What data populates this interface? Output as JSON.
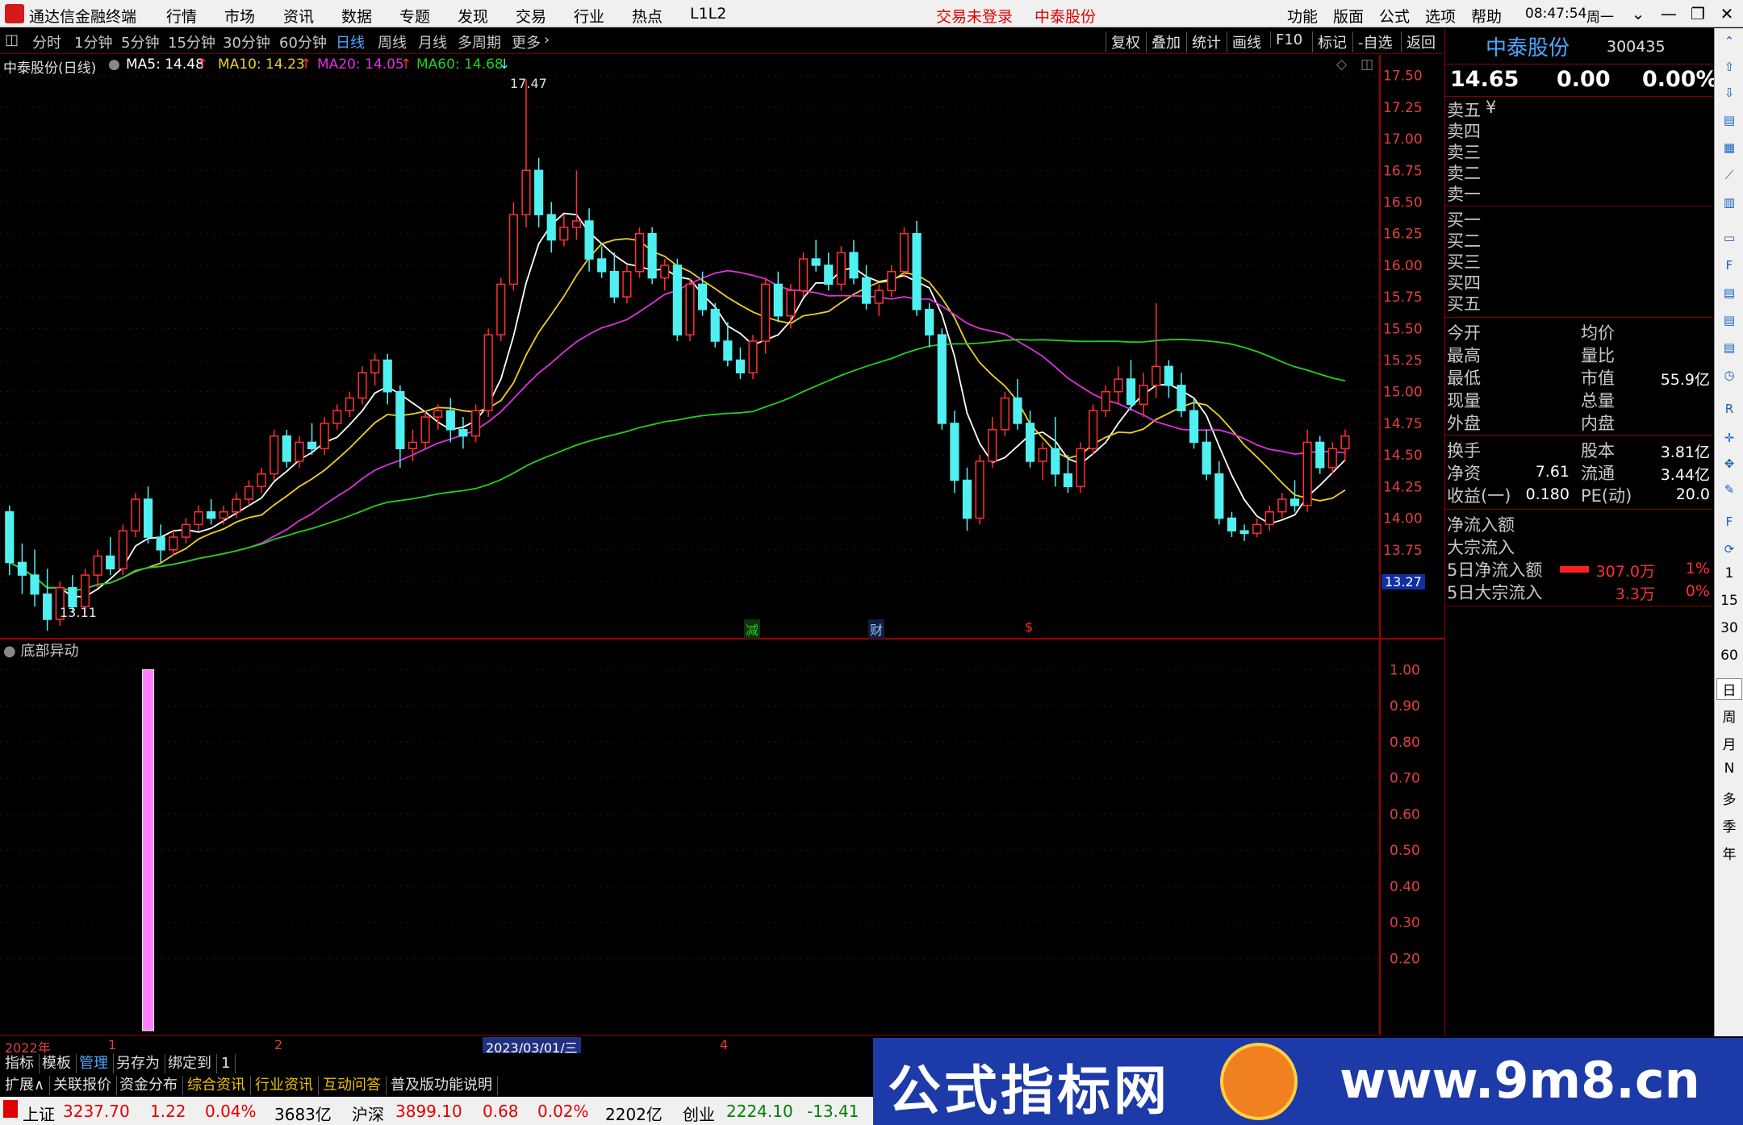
{
  "menubar": {
    "app_title": "通达信金融终端",
    "items": [
      "行情",
      "市场",
      "资讯",
      "数据",
      "专题",
      "发现",
      "交易",
      "行业",
      "热点",
      "L1L2"
    ],
    "login_status": "交易未登录",
    "stock_name": "中泰股份",
    "right_items": [
      "功能",
      "版面",
      "公式",
      "选项",
      "帮助"
    ],
    "clock": "08:47:54",
    "weekday": "周一"
  },
  "periodbar": {
    "items": [
      "分时",
      "1分钟",
      "5分钟",
      "15分钟",
      "30分钟",
      "60分钟",
      "日线",
      "周线",
      "月线",
      "多周期",
      "更多"
    ],
    "active": "日线",
    "right_items": [
      "复权",
      "叠加",
      "统计",
      "画线",
      "F10",
      "标记",
      "-自选",
      "返回"
    ]
  },
  "chart_info": {
    "title": "中泰股份(日线)",
    "ma5": "MA5: 14.48",
    "ma10": "MA10: 14.23",
    "ma20": "MA20: 14.05",
    "ma60": "MA60: 14.68",
    "high_label": "17.47",
    "low_label": "13.11",
    "price_tag": "13.27",
    "event_markers": [
      "减",
      "财",
      "$"
    ],
    "colors": {
      "ma5": "#ffffff",
      "ma10": "#f0d020",
      "ma20": "#e030e0",
      "ma60": "#20d020",
      "up": "#ff3030",
      "down": "#50f0f0"
    }
  },
  "chart_data": [
    {
      "type": "candlestick",
      "title": "中泰股份(日线)",
      "y_ticks": [
        "17.50",
        "17.25",
        "17.00",
        "16.75",
        "16.50",
        "16.25",
        "16.00",
        "15.75",
        "15.50",
        "15.25",
        "15.00",
        "14.75",
        "14.50",
        "14.25",
        "14.00",
        "13.75",
        "13.50"
      ],
      "ylim": [
        13.2,
        17.6
      ],
      "ohlc": [
        [
          14.05,
          14.1,
          13.55,
          13.65
        ],
        [
          13.65,
          13.8,
          13.4,
          13.55
        ],
        [
          13.55,
          13.75,
          13.3,
          13.4
        ],
        [
          13.4,
          13.6,
          13.11,
          13.2
        ],
        [
          13.2,
          13.5,
          13.15,
          13.45
        ],
        [
          13.45,
          13.55,
          13.25,
          13.3
        ],
        [
          13.3,
          13.6,
          13.25,
          13.55
        ],
        [
          13.55,
          13.75,
          13.45,
          13.7
        ],
        [
          13.7,
          13.85,
          13.55,
          13.6
        ],
        [
          13.6,
          13.95,
          13.55,
          13.9
        ],
        [
          13.9,
          14.2,
          13.85,
          14.15
        ],
        [
          14.15,
          14.25,
          13.8,
          13.85
        ],
        [
          13.85,
          13.95,
          13.65,
          13.75
        ],
        [
          13.75,
          13.9,
          13.7,
          13.85
        ],
        [
          13.85,
          14.0,
          13.8,
          13.95
        ],
        [
          13.95,
          14.1,
          13.9,
          14.05
        ],
        [
          14.05,
          14.15,
          13.95,
          14.0
        ],
        [
          14.0,
          14.1,
          13.95,
          14.05
        ],
        [
          14.05,
          14.2,
          14.0,
          14.15
        ],
        [
          14.15,
          14.3,
          14.1,
          14.25
        ],
        [
          14.25,
          14.4,
          14.2,
          14.35
        ],
        [
          14.35,
          14.7,
          14.3,
          14.65
        ],
        [
          14.65,
          14.7,
          14.4,
          14.45
        ],
        [
          14.45,
          14.65,
          14.4,
          14.6
        ],
        [
          14.6,
          14.75,
          14.5,
          14.55
        ],
        [
          14.55,
          14.8,
          14.5,
          14.75
        ],
        [
          14.75,
          14.9,
          14.7,
          14.85
        ],
        [
          14.85,
          15.0,
          14.8,
          14.95
        ],
        [
          14.95,
          15.2,
          14.9,
          15.15
        ],
        [
          15.15,
          15.3,
          15.05,
          15.25
        ],
        [
          15.25,
          15.3,
          14.9,
          15.0
        ],
        [
          15.0,
          15.05,
          14.4,
          14.55
        ],
        [
          14.55,
          14.7,
          14.45,
          14.6
        ],
        [
          14.6,
          14.85,
          14.55,
          14.8
        ],
        [
          14.8,
          14.9,
          14.7,
          14.85
        ],
        [
          14.85,
          14.95,
          14.6,
          14.7
        ],
        [
          14.7,
          14.8,
          14.55,
          14.65
        ],
        [
          14.65,
          14.9,
          14.6,
          14.85
        ],
        [
          14.85,
          15.5,
          14.8,
          15.45
        ],
        [
          15.45,
          15.9,
          15.4,
          15.85
        ],
        [
          15.85,
          16.5,
          15.8,
          16.4
        ],
        [
          16.4,
          17.47,
          16.3,
          16.75
        ],
        [
          16.75,
          16.85,
          16.3,
          16.4
        ],
        [
          16.4,
          16.5,
          16.1,
          16.2
        ],
        [
          16.2,
          16.4,
          16.15,
          16.3
        ],
        [
          16.3,
          16.75,
          16.2,
          16.35
        ],
        [
          16.35,
          16.45,
          15.95,
          16.05
        ],
        [
          16.05,
          16.15,
          15.9,
          15.95
        ],
        [
          15.95,
          16.1,
          15.7,
          15.75
        ],
        [
          15.75,
          16.0,
          15.7,
          15.95
        ],
        [
          15.95,
          16.3,
          15.9,
          16.25
        ],
        [
          16.25,
          16.3,
          15.85,
          15.9
        ],
        [
          15.9,
          16.05,
          15.8,
          16.0
        ],
        [
          16.0,
          16.05,
          15.4,
          15.45
        ],
        [
          15.45,
          15.9,
          15.4,
          15.85
        ],
        [
          15.85,
          15.95,
          15.6,
          15.65
        ],
        [
          15.65,
          15.7,
          15.35,
          15.4
        ],
        [
          15.4,
          15.55,
          15.2,
          15.25
        ],
        [
          15.25,
          15.35,
          15.1,
          15.15
        ],
        [
          15.15,
          15.45,
          15.1,
          15.4
        ],
        [
          15.4,
          15.9,
          15.3,
          15.85
        ],
        [
          15.85,
          15.95,
          15.55,
          15.6
        ],
        [
          15.6,
          15.85,
          15.5,
          15.8
        ],
        [
          15.8,
          16.1,
          15.75,
          16.05
        ],
        [
          16.05,
          16.2,
          15.95,
          16.0
        ],
        [
          16.0,
          16.1,
          15.8,
          15.85
        ],
        [
          15.85,
          16.15,
          15.8,
          16.1
        ],
        [
          16.1,
          16.2,
          15.85,
          15.9
        ],
        [
          15.9,
          16.0,
          15.65,
          15.7
        ],
        [
          15.7,
          15.85,
          15.6,
          15.8
        ],
        [
          15.8,
          16.0,
          15.75,
          15.95
        ],
        [
          15.95,
          16.3,
          15.9,
          16.25
        ],
        [
          16.25,
          16.35,
          15.6,
          15.65
        ],
        [
          15.65,
          15.7,
          15.35,
          15.45
        ],
        [
          15.45,
          15.5,
          14.7,
          14.75
        ],
        [
          14.75,
          14.85,
          14.2,
          14.3
        ],
        [
          14.3,
          14.4,
          13.9,
          14.0
        ],
        [
          14.0,
          14.5,
          13.95,
          14.45
        ],
        [
          14.45,
          14.8,
          14.4,
          14.7
        ],
        [
          14.7,
          15.0,
          14.65,
          14.95
        ],
        [
          14.95,
          15.1,
          14.7,
          14.75
        ],
        [
          14.75,
          14.85,
          14.4,
          14.45
        ],
        [
          14.45,
          14.6,
          14.3,
          14.55
        ],
        [
          14.55,
          14.8,
          14.25,
          14.35
        ],
        [
          14.35,
          14.5,
          14.2,
          14.25
        ],
        [
          14.25,
          14.6,
          14.2,
          14.55
        ],
        [
          14.55,
          14.9,
          14.5,
          14.85
        ],
        [
          14.85,
          15.05,
          14.8,
          15.0
        ],
        [
          15.0,
          15.2,
          14.9,
          15.1
        ],
        [
          15.1,
          15.25,
          14.85,
          14.9
        ],
        [
          14.9,
          15.15,
          14.8,
          15.05
        ],
        [
          15.05,
          15.7,
          14.95,
          15.2
        ],
        [
          15.2,
          15.25,
          14.95,
          15.05
        ],
        [
          15.05,
          15.15,
          14.8,
          14.85
        ],
        [
          14.85,
          14.95,
          14.55,
          14.6
        ],
        [
          14.6,
          14.7,
          14.3,
          14.35
        ],
        [
          14.35,
          14.45,
          13.95,
          14.0
        ],
        [
          14.0,
          14.05,
          13.85,
          13.9
        ],
        [
          13.9,
          13.95,
          13.82,
          13.88
        ],
        [
          13.88,
          14.0,
          13.85,
          13.95
        ],
        [
          13.95,
          14.1,
          13.9,
          14.05
        ],
        [
          14.05,
          14.2,
          14.0,
          14.15
        ],
        [
          14.15,
          14.3,
          14.05,
          14.1
        ],
        [
          14.1,
          14.7,
          14.05,
          14.6
        ],
        [
          14.6,
          14.65,
          14.35,
          14.4
        ],
        [
          14.4,
          14.6,
          14.35,
          14.55
        ],
        [
          14.55,
          14.7,
          14.45,
          14.65
        ]
      ]
    },
    {
      "type": "bar",
      "title": "底部异动",
      "y_ticks": [
        "1.00",
        "0.90",
        "0.80",
        "0.70",
        "0.60",
        "0.50",
        "0.40",
        "0.30",
        "0.20"
      ],
      "ylim": [
        0,
        1.05
      ],
      "signal_bars": [
        {
          "index": 11,
          "value": 1.0
        }
      ]
    }
  ],
  "date_axis": {
    "labels": [
      "2022年",
      "1",
      "2",
      "2023/03/01/三",
      "4"
    ]
  },
  "tabs_row1": [
    "指标",
    "模板",
    "管理",
    "另存为",
    "绑定到",
    "1"
  ],
  "tabs_row2": [
    "扩展∧",
    "关联报价",
    "资金分布",
    "综合资讯",
    "行业资讯",
    "互动问答",
    "普及版功能说明"
  ],
  "quote": {
    "name": "中泰股份",
    "code": "300435",
    "price": "14.65",
    "change": "0.00",
    "change_pct": "0.00%",
    "order_book": [
      "卖五",
      "卖四",
      "卖三",
      "卖二",
      "卖一",
      "买一",
      "买二",
      "买三",
      "买四",
      "买五"
    ],
    "sell5_suffix": "¥",
    "stats_left": [
      {
        "label": "今开",
        "value": ""
      },
      {
        "label": "最高",
        "value": ""
      },
      {
        "label": "最低",
        "value": ""
      },
      {
        "label": "现量",
        "value": ""
      },
      {
        "label": "外盘",
        "value": ""
      }
    ],
    "stats_right": [
      {
        "label": "均价",
        "value": ""
      },
      {
        "label": "量比",
        "value": ""
      },
      {
        "label": "市值",
        "value": "55.9亿"
      },
      {
        "label": "总量",
        "value": ""
      },
      {
        "label": "内盘",
        "value": ""
      }
    ],
    "fundamentals": [
      {
        "label": "换手",
        "value": "",
        "label2": "股本",
        "value2": "3.81亿"
      },
      {
        "label": "净资",
        "value": "7.61",
        "label2": "流通",
        "value2": "3.44亿"
      },
      {
        "label": "收益(一)",
        "value": "0.180",
        "label2": "PE(动)",
        "value2": "20.0"
      }
    ],
    "flows": [
      {
        "label": "净流入额",
        "value": "",
        "pct": ""
      },
      {
        "label": "大宗流入",
        "value": "",
        "pct": ""
      },
      {
        "label": "5日净流入额",
        "value": "307.0万",
        "pct": "1%"
      },
      {
        "label": "5日大宗流入",
        "value": "3.3万",
        "pct": "0%"
      }
    ]
  },
  "iconbar": {
    "period_labels": [
      "1",
      "15",
      "30",
      "60",
      "日",
      "周",
      "月",
      "N",
      "多",
      "季",
      "年"
    ]
  },
  "statusbar": {
    "sh_label": "上证",
    "sh_value": "3237.70",
    "sh_change": "1.22",
    "sh_pct": "0.04%",
    "sh_amount": "3683亿",
    "sz_label": "沪深",
    "sz_value": "3899.10",
    "sz_change": "0.68",
    "sz_pct": "0.02%",
    "sz_amount": "2202亿",
    "cy_label": "创业",
    "cy_value": "2224.10",
    "cy_change": "-13.41"
  },
  "banner": {
    "left_text": "公式指标网",
    "right_text": "www.9m8.cn"
  }
}
